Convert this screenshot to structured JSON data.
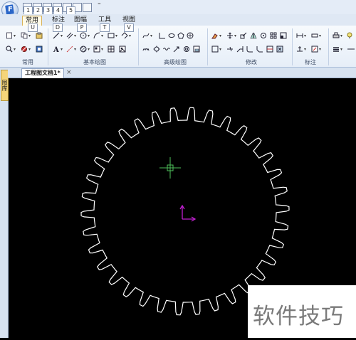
{
  "app": {
    "logo_letter": "F"
  },
  "quick_access": {
    "keytips": [
      "1",
      "2",
      "3",
      "4",
      "5"
    ],
    "more": "⁼"
  },
  "ribbon": {
    "tabs": [
      {
        "label": "常用",
        "keytip": "U",
        "active": true
      },
      {
        "label": "标注",
        "keytip": "D",
        "active": false
      },
      {
        "label": "图幅",
        "keytip": "P",
        "active": false
      },
      {
        "label": "工具",
        "keytip": "T",
        "active": false
      },
      {
        "label": "视图",
        "keytip": "V",
        "active": false
      }
    ],
    "groups": [
      {
        "label": "常用"
      },
      {
        "label": "基本绘图"
      },
      {
        "label": "高级绘图"
      },
      {
        "label": "修改"
      },
      {
        "label": "标注"
      }
    ]
  },
  "document": {
    "tab_title": "工程图文档1*",
    "close_glyph": "×",
    "side_panel_label": "图库"
  },
  "canvas": {
    "background": "#000000",
    "gear": {
      "color": "#ffffff",
      "tooth_count": 34
    },
    "crosshair_color": "#4ec05a",
    "axis_color": "#c020d0"
  },
  "watermark": {
    "text": "软件技巧"
  }
}
